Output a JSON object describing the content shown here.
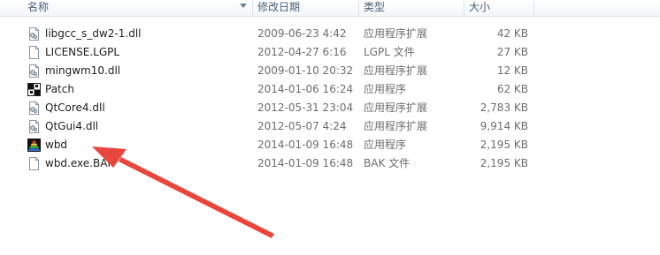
{
  "columns": {
    "name": "名称",
    "date": "修改日期",
    "type": "类型",
    "size": "大小"
  },
  "files": [
    {
      "name": "libgcc_s_dw2-1.dll",
      "date": "2009-06-23 4:42",
      "type": "应用程序扩展",
      "size": "42 KB",
      "icon": "dll-file-icon"
    },
    {
      "name": "LICENSE.LGPL",
      "date": "2012-04-27 6:16",
      "type": "LGPL 文件",
      "size": "27 KB",
      "icon": "generic-file-icon"
    },
    {
      "name": "mingwm10.dll",
      "date": "2009-01-10 20:32",
      "type": "应用程序扩展",
      "size": "12 KB",
      "icon": "dll-file-icon"
    },
    {
      "name": "Patch",
      "date": "2014-01-06 16:24",
      "type": "应用程序",
      "size": "62 KB",
      "icon": "checker-app-icon"
    },
    {
      "name": "QtCore4.dll",
      "date": "2012-05-31 23:04",
      "type": "应用程序扩展",
      "size": "2,783 KB",
      "icon": "dll-file-icon"
    },
    {
      "name": "QtGui4.dll",
      "date": "2012-05-07 4:24",
      "type": "应用程序扩展",
      "size": "9,914 KB",
      "icon": "dll-file-icon"
    },
    {
      "name": "wbd",
      "date": "2014-01-09 16:48",
      "type": "应用程序",
      "size": "2,195 KB",
      "icon": "pyramid-app-icon"
    },
    {
      "name": "wbd.exe.BAK",
      "date": "2014-01-09 16:48",
      "type": "BAK 文件",
      "size": "2,195 KB",
      "icon": "generic-file-icon"
    }
  ],
  "annotation_color": "#e8453c"
}
